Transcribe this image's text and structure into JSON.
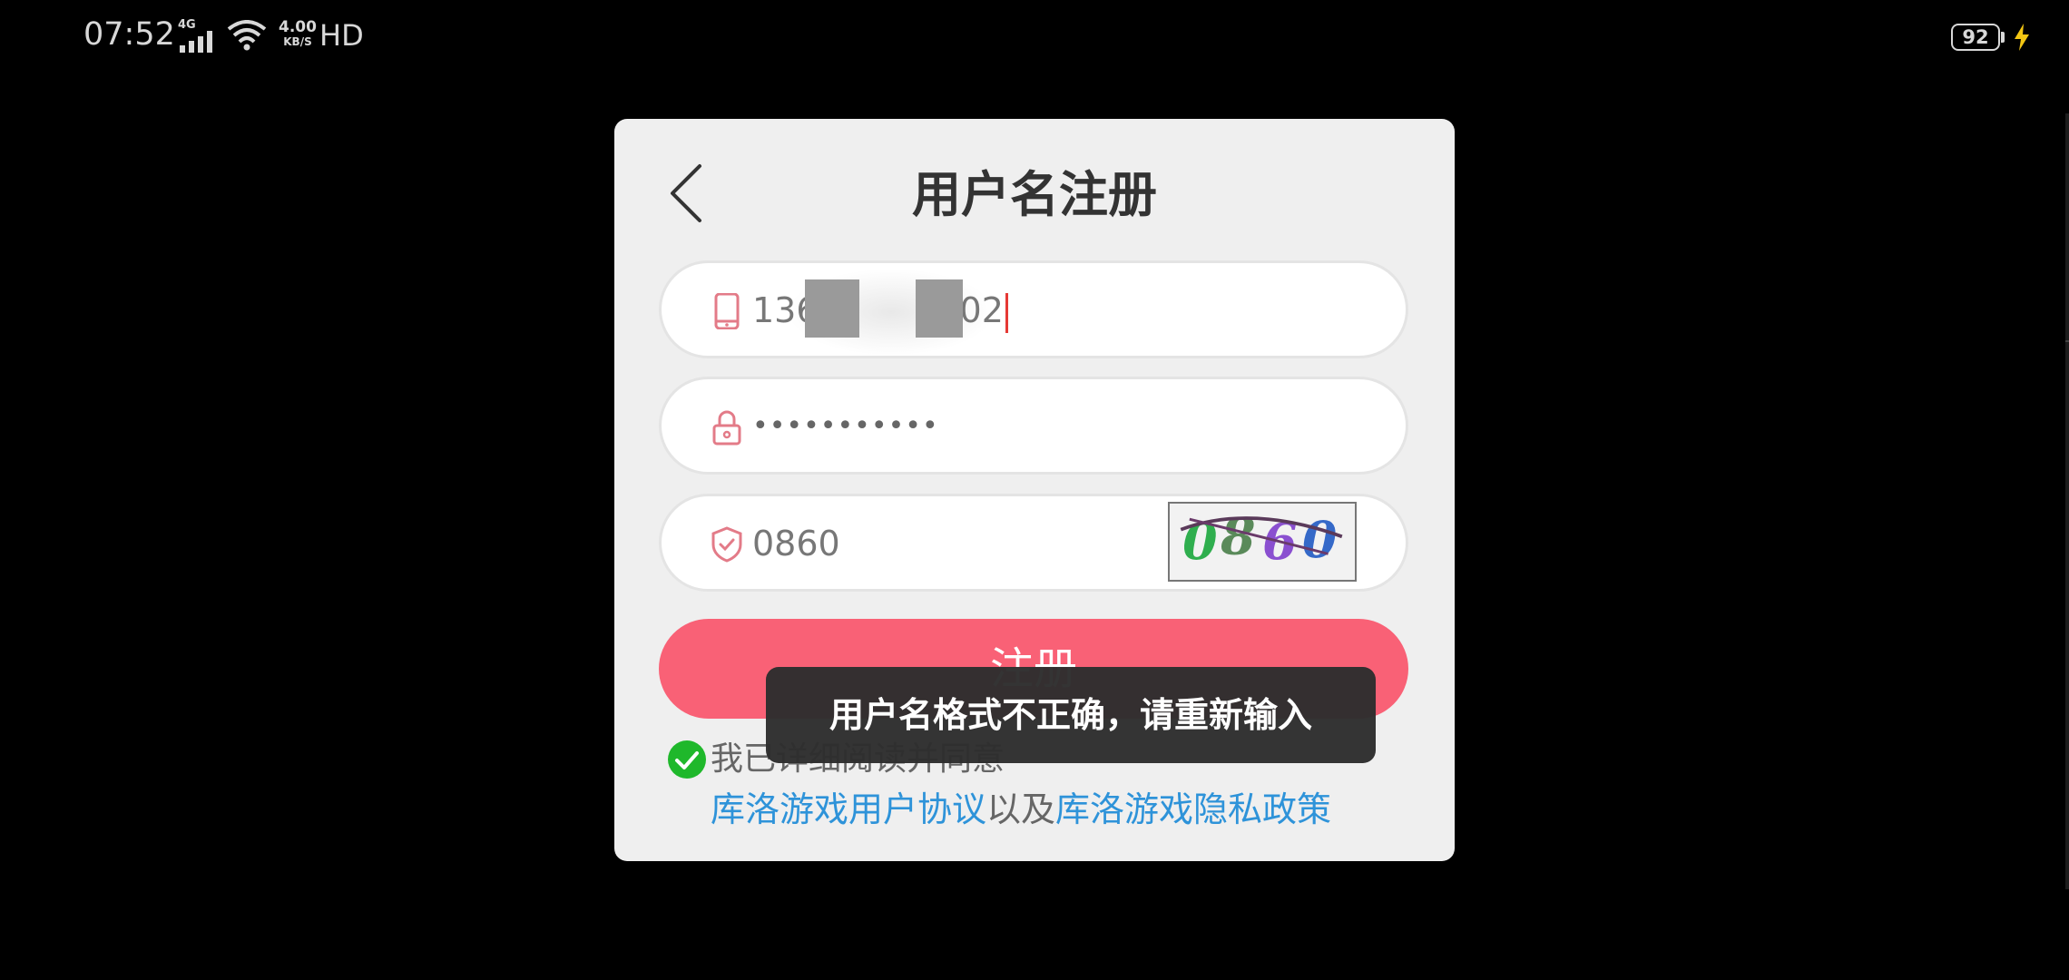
{
  "status_bar": {
    "time": "07:52",
    "network": "4G",
    "speed_value": "4.00",
    "speed_unit": "KB/S",
    "hd": "HD",
    "battery": "92"
  },
  "dialog": {
    "title": "用户名注册",
    "phone_field": {
      "value_start": "136",
      "value_end": "02",
      "icon": "phone-icon"
    },
    "password_field": {
      "value": "•••••••••••",
      "icon": "lock-icon"
    },
    "captcha_field": {
      "value": "0860",
      "icon": "shield-check-icon",
      "captcha_image_text": "0860"
    },
    "submit_label": "注册",
    "agreement": {
      "checked": true,
      "text": "我已详细阅读并同意",
      "user_agreement_link": "库洛游戏用户协议",
      "connector": "以及",
      "privacy_link": "库洛游戏隐私政策"
    }
  },
  "toast": {
    "message": "用户名格式不正确，请重新输入"
  },
  "colors": {
    "accent": "#f96176",
    "link": "#2e93d9",
    "check": "#1fb82b",
    "dialog_bg": "#efefef"
  }
}
